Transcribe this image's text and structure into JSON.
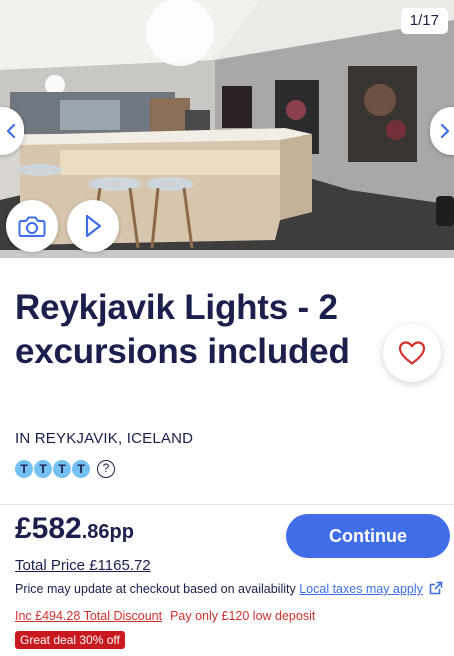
{
  "gallery": {
    "counter": "1/17",
    "prev_icon": "chevron-left-icon",
    "next_icon": "chevron-right-icon",
    "camera_icon": "camera-icon",
    "play_icon": "play-icon"
  },
  "hotel": {
    "title": "Reykjavik Lights - 2 excursions included",
    "location": "IN REYKJAVIK, ICELAND",
    "rating_letters": [
      "T",
      "T",
      "T",
      "T"
    ],
    "rating_help": "?",
    "favourite_icon": "heart-icon"
  },
  "pricing": {
    "price_main": "£582",
    "price_decimal": ".86pp",
    "continue_label": "Continue",
    "total_price": "Total Price £1165.72",
    "update_note": "Price may update at checkout based on availability",
    "taxes_link": "Local taxes may apply",
    "discount": "Inc £494.28 Total Discount",
    "deposit": "Pay only £120 low deposit",
    "deal_badge": "Great deal 30% off"
  },
  "colors": {
    "primary_text": "#1b1f4b",
    "accent_blue": "#3f6ee8",
    "rating_blue": "#74c0f0",
    "discount_red": "#d0312d",
    "badge_red": "#c8191f"
  }
}
